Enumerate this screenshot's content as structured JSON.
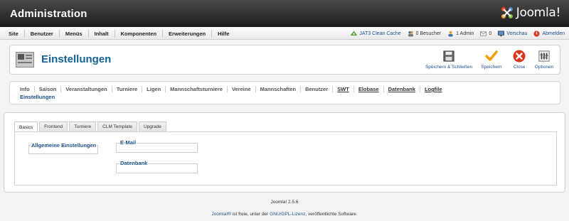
{
  "header": {
    "title": "Administration",
    "logo_text": "Joomla!"
  },
  "menubar": {
    "items": [
      "Site",
      "Benutzer",
      "Menüs",
      "Inhalt",
      "Komponenten",
      "Erweiterungen",
      "Hilfe"
    ],
    "status": {
      "cache": "JAT3 Clean Cache",
      "visitors": "0 Besucher",
      "admins": "1 Admin",
      "messages": "0",
      "preview": "Vorschau",
      "logout": "Abmelden"
    }
  },
  "toolbar": {
    "page_title": "Einstellungen",
    "save_close": "Speichern & Schließen",
    "save": "Speichern",
    "close": "Close",
    "options": "Optionen"
  },
  "submenu": {
    "items": [
      "Info",
      "Saison",
      "Veranstaltungen",
      "Turniere",
      "Ligen",
      "Mannschaftsturniere",
      "Vereine",
      "Mannschaften",
      "Benutzer",
      "SWT",
      "Elobase",
      "Datenbank",
      "Logfile"
    ],
    "active": "Einstellungen"
  },
  "tabs": [
    "Basics",
    "Frontend",
    "Turniere",
    "CLM Template",
    "Upgrade"
  ],
  "fieldsets": {
    "general": "Allgemeine Einstellungen",
    "email": "E-Mail",
    "database": "Datenbank"
  },
  "footer": {
    "version": "Joomla! 2.5.6",
    "license_prefix": "Joomla!®",
    "license_mid": " ist freie, unter der ",
    "license_link": "GNU/GPL-Lizenz",
    "license_suffix": ", veröffentlichte Software."
  },
  "colors": {
    "accent": "#146295",
    "link": "#1a4f8b",
    "header_bg": "#2b2b2b"
  }
}
